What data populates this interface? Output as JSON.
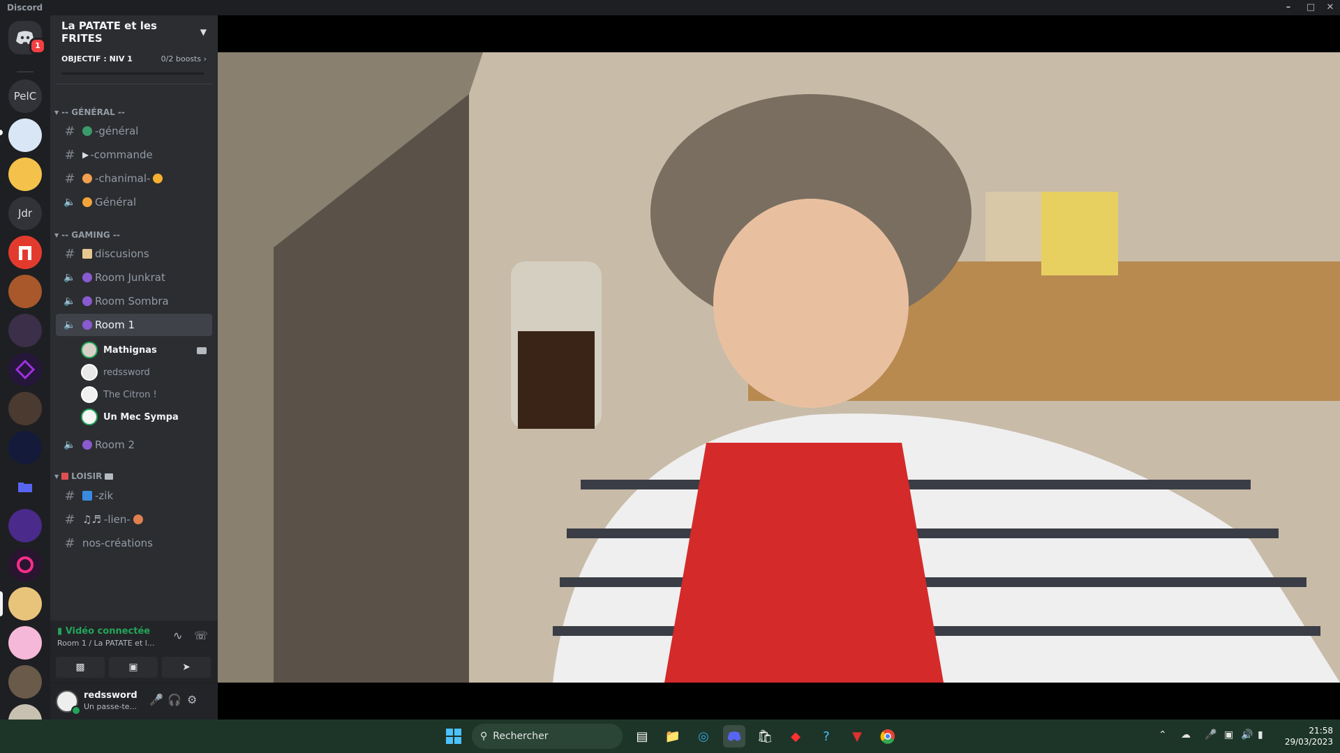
{
  "window": {
    "app_name": "Discord"
  },
  "rail": {
    "home_badge": "1",
    "text_servers": [
      "PelC",
      "Jdr"
    ]
  },
  "server": {
    "name": "La PATATE et les FRITES",
    "boost_goal": "OBJECTIF : NIV 1",
    "boost_count": "0/2 boosts"
  },
  "categories": {
    "general": "-- GÉNÉRAL --",
    "gaming": "-- GAMING --",
    "loisir": "LOISIR"
  },
  "channels": {
    "general": "-général",
    "commande": "-commande",
    "chanimal": "-chanimal-",
    "general_voice": "Général",
    "discusions": "discusions",
    "room_junkrat": "Room Junkrat",
    "room_sombra": "Room Sombra",
    "room1": "Room 1",
    "room2": "Room 2",
    "zik": "-zik",
    "lien": "-lien-",
    "nos_creations": "nos-créations"
  },
  "voice_users": [
    {
      "name": "Mathignas"
    },
    {
      "name": "redssword"
    },
    {
      "name": "The Citron !"
    },
    {
      "name": "Un Mec Sympa"
    }
  ],
  "voice_panel": {
    "status": "Vidéo connectée",
    "location": "Room 1 / La PATATE et l..."
  },
  "user_panel": {
    "username": "redssword",
    "status": "Un passe-te..."
  },
  "taskbar": {
    "search_placeholder": "Rechercher",
    "time": "21:58",
    "date": "29/03/2023"
  },
  "colors": {
    "connected_green": "#23a55a",
    "badge_red": "#f23f43",
    "sidebar_bg": "#2b2d31",
    "rail_bg": "#1e1f22"
  }
}
